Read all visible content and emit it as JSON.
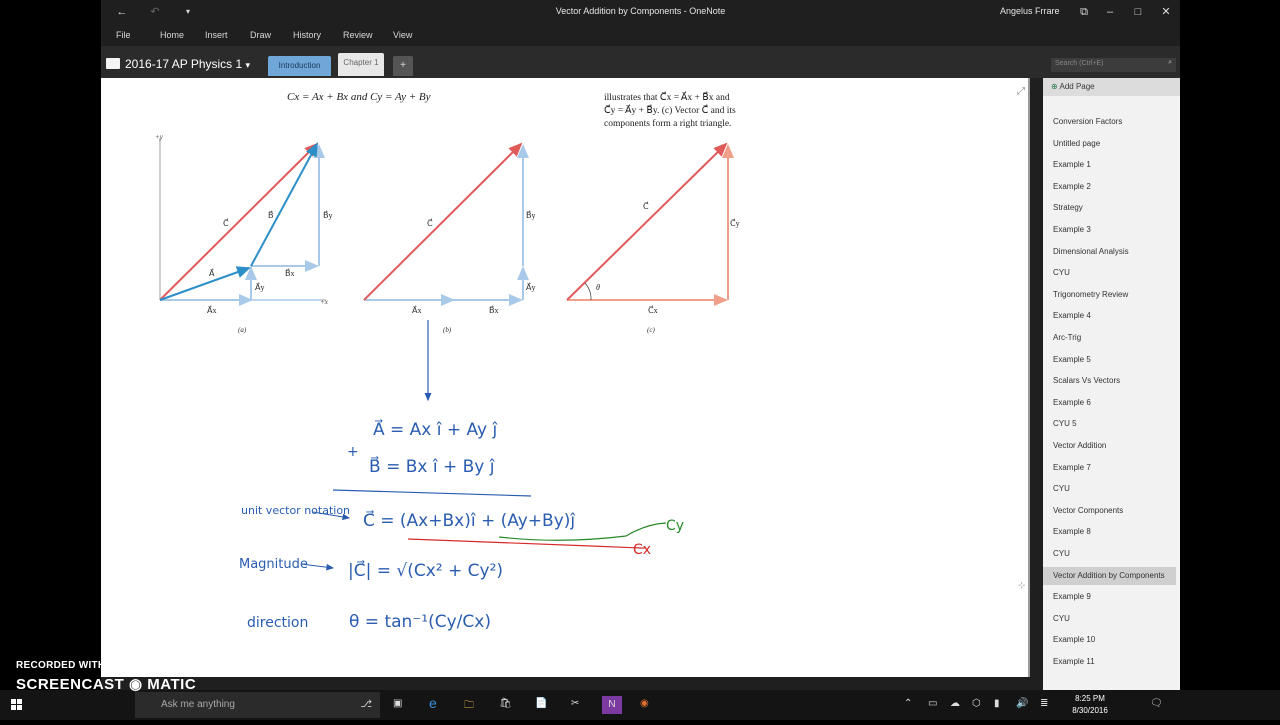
{
  "window": {
    "title": "Vector Addition by Components - OneNote",
    "user": "Angelus Frrare"
  },
  "ribbon": {
    "tabs": [
      "File",
      "Home",
      "Insert",
      "Draw",
      "History",
      "Review",
      "View"
    ]
  },
  "notebook": {
    "name": "2016-17 AP Physics 1",
    "sections": [
      "Introduction",
      "Chapter 1",
      "+"
    ],
    "active_section": "Chapter 1",
    "search_placeholder": "Search (Ctrl+E)"
  },
  "figure": {
    "equation_top": "Cx = Ax + Bx   and   Cy = Ay + By",
    "caption_line1": "illustrates that C⃗x = A⃗x + B⃗x and",
    "caption_line2": "C⃗y = A⃗y + B⃗y. (c) Vector C⃗ and its",
    "caption_line3": "components form a right triangle.",
    "label_a": "(a)",
    "label_b": "(b)",
    "label_c": "(c)"
  },
  "notes": {
    "line_a": "A⃗ = Ax î + Ay ĵ",
    "line_b": "B⃗ = Bx î + By ĵ",
    "unit_vector_label": "unit vector notation",
    "line_c": "C⃗ = (Ax+Bx)î + (Ay+By)ĵ",
    "magnitude_label": "Magnitude",
    "magnitude_eq": "|C⃗| = √(Cx² + Cy²)",
    "direction_label": "direction",
    "direction_eq": "θ = tan⁻¹(Cy/Cx)",
    "cy_label": "Cy",
    "cx_label": "Cx"
  },
  "pagelist": {
    "add_page": "Add Page",
    "pages": [
      "Conversion Factors",
      "Untitled page",
      "Example 1",
      "Example 2",
      "Strategy",
      "Example 3",
      "Dimensional Analysis",
      "CYU",
      "Trigonometry Review",
      "Example 4",
      "Arc-Trig",
      "Example 5",
      "Scalars Vs Vectors",
      "Example 6",
      "CYU 5",
      "Vector Addition",
      "Example 7",
      "CYU",
      "Vector Components",
      "Example 8",
      "CYU",
      "Vector Addition by Components",
      "Example 9",
      "CYU",
      "Example 10",
      "Example 11"
    ],
    "selected": "Vector Addition by Components"
  },
  "taskbar": {
    "search_placeholder": "Ask me anything",
    "time": "8:25 PM",
    "date": "8/30/2016"
  },
  "watermark": {
    "top": "RECORDED WITH",
    "bottom": "SCREENCAST ◉ MATIC"
  },
  "colors": {
    "red_vector": "#e05a5a",
    "blue_vector": "#2d8fc8",
    "light_blue": "#a9c9e8",
    "ink_blue": "#2a5db0",
    "ink_red": "#d42a2a",
    "ink_green": "#2a8a2a"
  }
}
